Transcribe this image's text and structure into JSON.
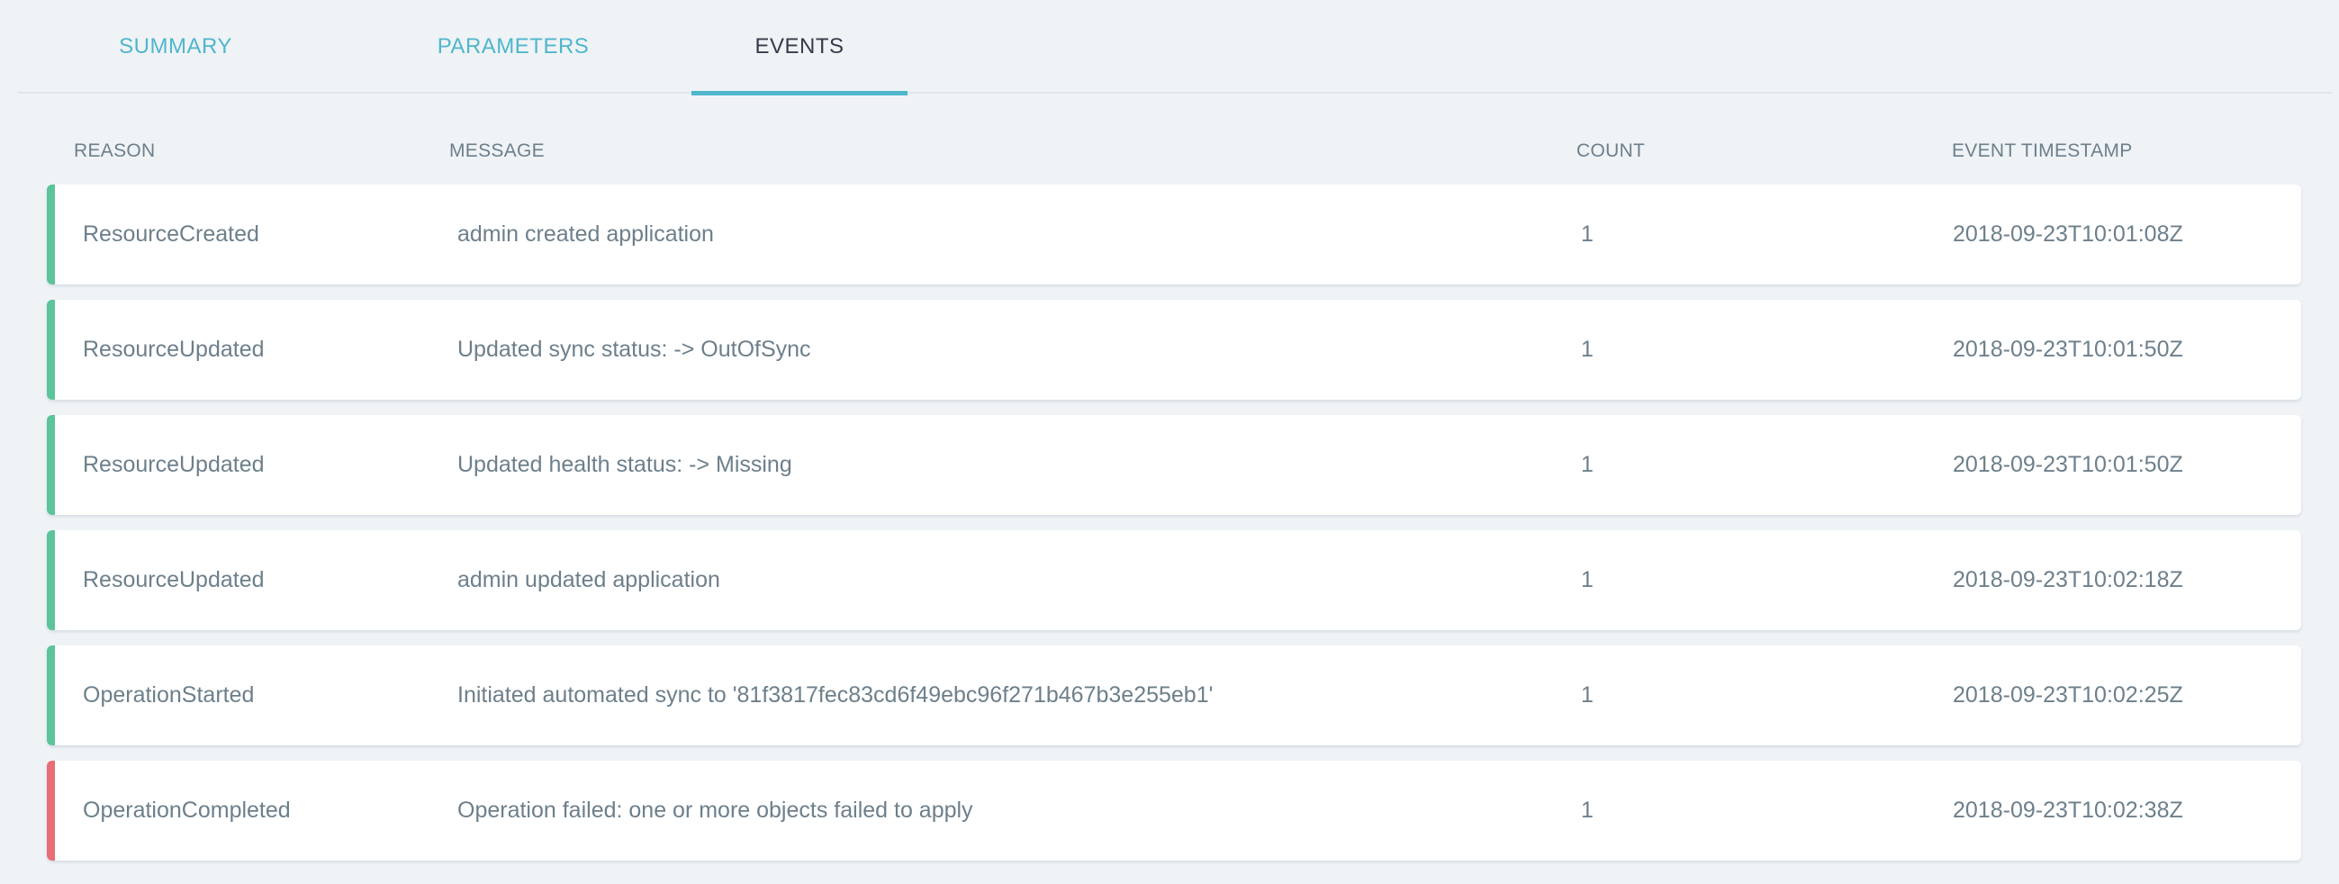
{
  "tabs": [
    {
      "label": "SUMMARY",
      "active": false
    },
    {
      "label": "PARAMETERS",
      "active": false
    },
    {
      "label": "EVENTS",
      "active": true
    }
  ],
  "colors": {
    "accent": "#4fb6cc",
    "success": "#5cc39a",
    "failure": "#e96d76",
    "background": "#eff3f6"
  },
  "table": {
    "headers": {
      "reason": "REASON",
      "message": "MESSAGE",
      "count": "COUNT",
      "timestamp": "EVENT TIMESTAMP"
    },
    "rows": [
      {
        "status": "success",
        "reason": "ResourceCreated",
        "message": "admin created application",
        "count": "1",
        "timestamp": "2018-09-23T10:01:08Z"
      },
      {
        "status": "success",
        "reason": "ResourceUpdated",
        "message": "Updated sync status: -> OutOfSync",
        "count": "1",
        "timestamp": "2018-09-23T10:01:50Z"
      },
      {
        "status": "success",
        "reason": "ResourceUpdated",
        "message": "Updated health status: -> Missing",
        "count": "1",
        "timestamp": "2018-09-23T10:01:50Z"
      },
      {
        "status": "success",
        "reason": "ResourceUpdated",
        "message": "admin updated application",
        "count": "1",
        "timestamp": "2018-09-23T10:02:18Z"
      },
      {
        "status": "success",
        "reason": "OperationStarted",
        "message": "Initiated automated sync to '81f3817fec83cd6f49ebc96f271b467b3e255eb1'",
        "count": "1",
        "timestamp": "2018-09-23T10:02:25Z"
      },
      {
        "status": "failure",
        "reason": "OperationCompleted",
        "message": "Operation failed: one or more objects failed to apply",
        "count": "1",
        "timestamp": "2018-09-23T10:02:38Z"
      }
    ]
  }
}
